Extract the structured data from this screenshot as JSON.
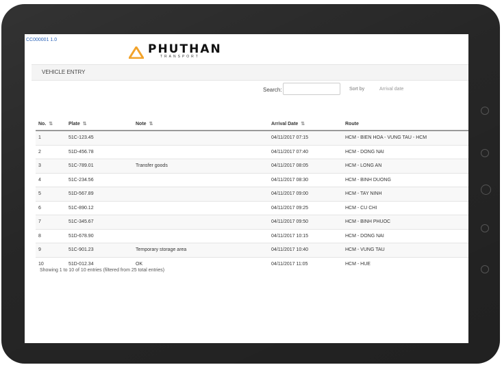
{
  "header": {
    "user_link": "CC000001 1.0",
    "logo_word": "PHUTHAN",
    "logo_tagline": "TRANSPORT"
  },
  "subbar": {
    "title": "VEHICLE ENTRY"
  },
  "search": {
    "label": "Search:",
    "placeholder": ""
  },
  "sort": {
    "label": "Sort by",
    "value": "Arrival date"
  },
  "table": {
    "columns": [
      "No.",
      "Plate",
      "Note",
      "Arrival Date",
      "Route"
    ],
    "rows": [
      {
        "no": "1",
        "plate": "51C-123.45",
        "note": "",
        "date": "04/11/2017 07:15",
        "route": "HCM - BIEN HOA - VUNG TAU - HCM"
      },
      {
        "no": "2",
        "plate": "51D-456.78",
        "note": "",
        "date": "04/11/2017 07:40",
        "route": "HCM - DONG NAI"
      },
      {
        "no": "3",
        "plate": "51C-789.01",
        "note": "Transfer goods",
        "date": "04/11/2017 08:05",
        "route": "HCM - LONG AN"
      },
      {
        "no": "4",
        "plate": "51C-234.56",
        "note": "",
        "date": "04/11/2017 08:30",
        "route": "HCM - BINH DUONG"
      },
      {
        "no": "5",
        "plate": "51D-567.89",
        "note": "",
        "date": "04/11/2017 09:00",
        "route": "HCM - TAY NINH"
      },
      {
        "no": "6",
        "plate": "51C-890.12",
        "note": "",
        "date": "04/11/2017 09:25",
        "route": "HCM - CU CHI"
      },
      {
        "no": "7",
        "plate": "51C-345.67",
        "note": "",
        "date": "04/11/2017 09:50",
        "route": "HCM - BINH PHUOC"
      },
      {
        "no": "8",
        "plate": "51D-678.90",
        "note": "",
        "date": "04/11/2017 10:15",
        "route": "HCM - DONG NAI"
      },
      {
        "no": "9",
        "plate": "51C-901.23",
        "note": "Temporary storage area",
        "date": "04/11/2017 10:40",
        "route": "HCM - VUNG TAU"
      },
      {
        "no": "10",
        "plate": "51D-012.34",
        "note": "OK",
        "date": "04/11/2017 11:05",
        "route": "HCM - HUE"
      }
    ]
  },
  "footer": {
    "info": "Showing 1 to 10 of 10 entries (filtered from 25 total entries)"
  }
}
